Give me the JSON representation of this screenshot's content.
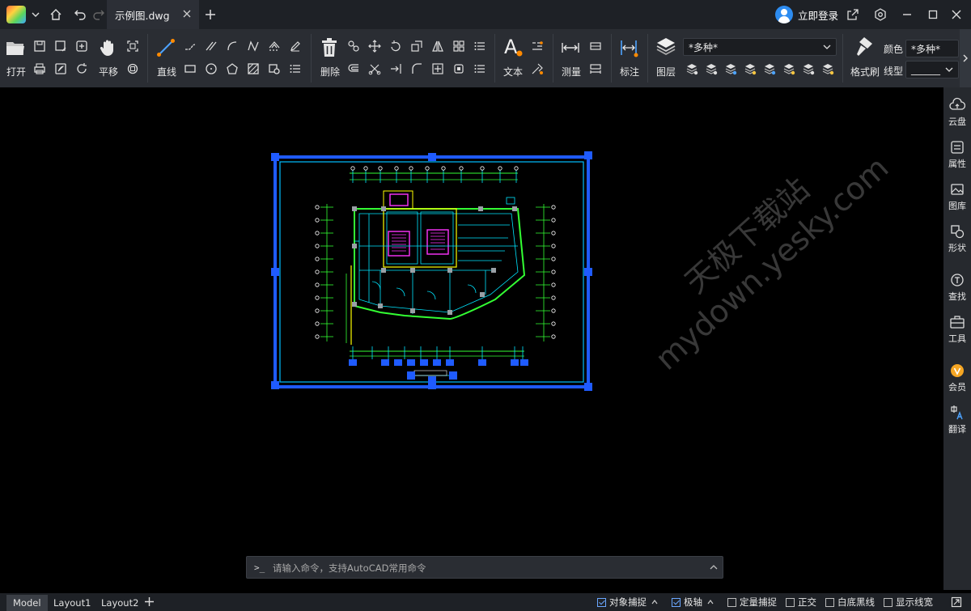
{
  "titlebar": {
    "document_tab": "示例图.dwg",
    "login_label": "立即登录",
    "icons": [
      "app-logo",
      "chevron-down-icon",
      "home-icon",
      "undo-icon",
      "redo-icon",
      "close-icon",
      "add-tab-icon",
      "share-icon",
      "settings-icon",
      "minimize-icon",
      "maximize-icon",
      "close-window-icon"
    ]
  },
  "ribbon": {
    "open_label": "打开",
    "pan_label": "平移",
    "line_label": "直线",
    "delete_label": "删除",
    "text_label": "文本",
    "measure_label": "测量",
    "dimension_label": "标注",
    "layer_label": "图层",
    "layer_value": "*多种*",
    "format_painter_label": "格式刷",
    "color_label": "颜色",
    "color_value": "*多种*",
    "linetype_label": "线型",
    "linetype_value": "______"
  },
  "right_panel": {
    "items": [
      {
        "label": "云盘",
        "icon": "cloud-icon"
      },
      {
        "label": "属性",
        "icon": "properties-icon"
      },
      {
        "label": "图库",
        "icon": "gallery-icon"
      },
      {
        "label": "形状",
        "icon": "shapes-icon"
      },
      {
        "label": "查找",
        "icon": "find-icon"
      },
      {
        "label": "工具",
        "icon": "toolbox-icon"
      },
      {
        "label": "会员",
        "icon": "vip-icon"
      },
      {
        "label": "翻译",
        "icon": "translate-icon"
      }
    ]
  },
  "canvas": {
    "watermark_line1": "天极下载站",
    "watermark_line2": "mydown.yesky.com"
  },
  "command_line": {
    "prompt": ">_",
    "placeholder": "请输入命令，支持AutoCAD常用命令"
  },
  "status_bar": {
    "tabs": [
      "Model",
      "Layout1",
      "Layout2"
    ],
    "active_tab": "Model",
    "toggles": [
      {
        "label": "对象捕捉",
        "checked": true
      },
      {
        "label": "极轴",
        "checked": true
      },
      {
        "label": "定量捕捉",
        "checked": false
      },
      {
        "label": "正交",
        "checked": false
      },
      {
        "label": "白底黑线",
        "checked": false
      },
      {
        "label": "显示线宽",
        "checked": false
      }
    ]
  },
  "colors": {
    "canvas_bg": "#000000",
    "ribbon_bg": "#2a2d33",
    "titlebar_bg": "#1e2126",
    "selection_blue": "#1f5bff",
    "drawing_cyan": "#00e5ff",
    "drawing_green": "#33ff33",
    "drawing_magenta": "#ff33ff",
    "drawing_yellow": "#ffff00",
    "vip_badge": "#f5a623"
  }
}
